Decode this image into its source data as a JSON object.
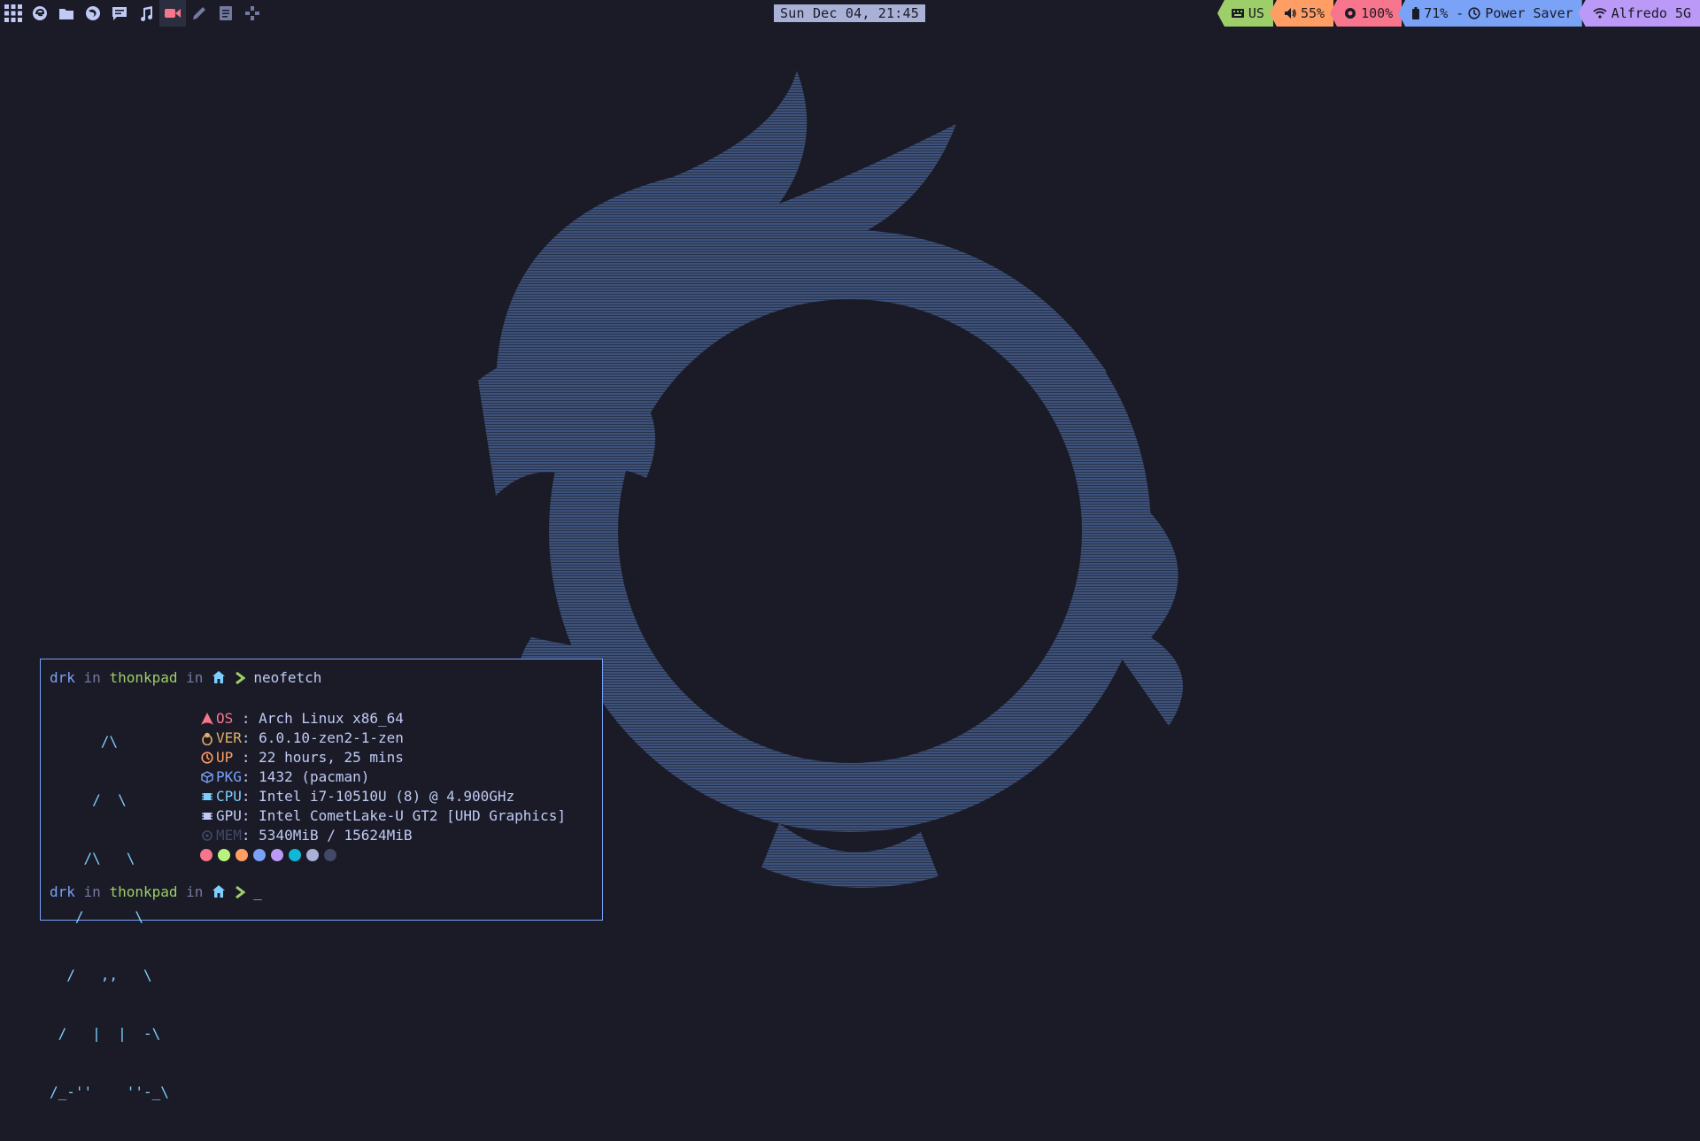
{
  "topbar": {
    "launchers": [
      {
        "icon": "apps-grid-icon",
        "color": "#c0caf5"
      },
      {
        "icon": "browser-icon",
        "color": "#c0caf5"
      },
      {
        "icon": "folder-icon",
        "color": "#c0caf5"
      },
      {
        "icon": "firefox-icon",
        "color": "#c0caf5"
      },
      {
        "icon": "chat-icon",
        "color": "#c0caf5"
      },
      {
        "icon": "music-icon",
        "color": "#c0caf5"
      },
      {
        "icon": "record-icon",
        "color": "#f7768e"
      },
      {
        "icon": "pen-icon",
        "color": "#737aa2"
      },
      {
        "icon": "notes-icon",
        "color": "#737aa2"
      },
      {
        "icon": "gamepad-icon",
        "color": "#737aa2"
      }
    ],
    "clock": "Sun Dec 04, 21:45",
    "status": {
      "keyboard": "US",
      "volume": "55%",
      "brightness": "100%",
      "battery": "71% - ",
      "power_mode": "Power Saver",
      "wifi": "Alfredo 5G"
    }
  },
  "terminal": {
    "prompt": {
      "user": "drk",
      "in1": " in ",
      "host": "thonkpad",
      "in2": " in "
    },
    "command": "neofetch",
    "art": [
      "      /\\",
      "     /  \\",
      "    /\\   \\",
      "   /      \\",
      "  /   ,,   \\",
      " /   |  |  -\\",
      "/_-''    ''-_\\"
    ],
    "info": [
      {
        "icon": "arch-icon",
        "key": "OS ",
        "sep": ": ",
        "value": "Arch Linux x86_64",
        "color": "#f7768e"
      },
      {
        "icon": "tux-icon",
        "key": "VER",
        "sep": ": ",
        "value": "6.0.10-zen2-1-zen",
        "color": "#e0af68"
      },
      {
        "icon": "clock-icon",
        "key": "UP ",
        "sep": ": ",
        "value": "22 hours, 25 mins",
        "color": "#ff9e64"
      },
      {
        "icon": "package-icon",
        "key": "PKG",
        "sep": ": ",
        "value": "1432 (pacman)",
        "color": "#7aa2f7"
      },
      {
        "icon": "cpu-icon",
        "key": "CPU",
        "sep": ": ",
        "value": "Intel i7-10510U (8) @ 4.900GHz",
        "color": "#7dcfff"
      },
      {
        "icon": "gpu-icon",
        "key": "GPU",
        "sep": ": ",
        "value": "Intel CometLake-U GT2 [UHD Graphics]",
        "color": "#c0caf5"
      },
      {
        "icon": "memory-icon",
        "key": "MEM",
        "sep": ": ",
        "value": "5340MiB / 15624MiB",
        "color": "#414868"
      }
    ],
    "palette": [
      "#f7768e",
      "#b9f27c",
      "#ff9e64",
      "#7aa2f7",
      "#bb9af7",
      "#0db9d7",
      "#a9b1d6",
      "#414868"
    ],
    "cursor": "_"
  }
}
